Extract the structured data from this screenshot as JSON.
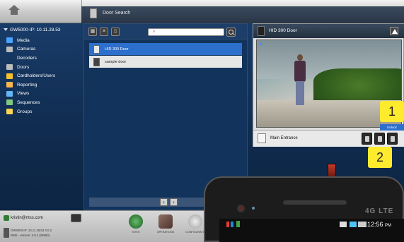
{
  "window": {
    "title": "Door Search"
  },
  "nav": {
    "server": "GW5000-IP: 10.11.28.53",
    "items": [
      {
        "label": "Media",
        "color": "#4aa3ff",
        "sub": false
      },
      {
        "label": "Cameras",
        "color": "#bdbdbd",
        "sub": false
      },
      {
        "label": "Decoders",
        "color": "#bdbdbd",
        "sub": true
      },
      {
        "label": "Doors",
        "color": "#bdbdbd",
        "sub": false
      },
      {
        "label": "Cardholders/Users",
        "color": "#fbc02d",
        "sub": false
      },
      {
        "label": "Reporting",
        "color": "#ffb74d",
        "sub": false
      },
      {
        "label": "Views",
        "color": "#64b5f6",
        "sub": false
      },
      {
        "label": "Sequences",
        "color": "#81c784",
        "sub": false
      },
      {
        "label": "Groups",
        "color": "#ffd54f",
        "sub": false
      }
    ]
  },
  "door_search": {
    "search_placeholder": "",
    "rows": [
      {
        "label": "HID 300 Door",
        "selected": true
      },
      {
        "label": "sample door",
        "selected": false
      }
    ],
    "pager_label": "page 1"
  },
  "video_panel": {
    "title": "HID 300 Door",
    "door_label": "Main Entrance",
    "unlock_label": "Unlock"
  },
  "callouts": {
    "one": "1",
    "two": "2"
  },
  "status": {
    "user": "kristin@ntss.com",
    "server_line": "GW5000-IP: 10.11.28.53 3.0.2",
    "version_line": "RMS - version: 3.0.2 (28653)"
  },
  "dock": [
    {
      "label": "sites",
      "color": "#2e7d32"
    },
    {
      "label": "operations",
      "color": "#6d4c41"
    },
    {
      "label": "configuration",
      "color": "#757575"
    }
  ],
  "phone": {
    "brand": "4G LTE",
    "time": "12:56",
    "ampm": "PM"
  }
}
